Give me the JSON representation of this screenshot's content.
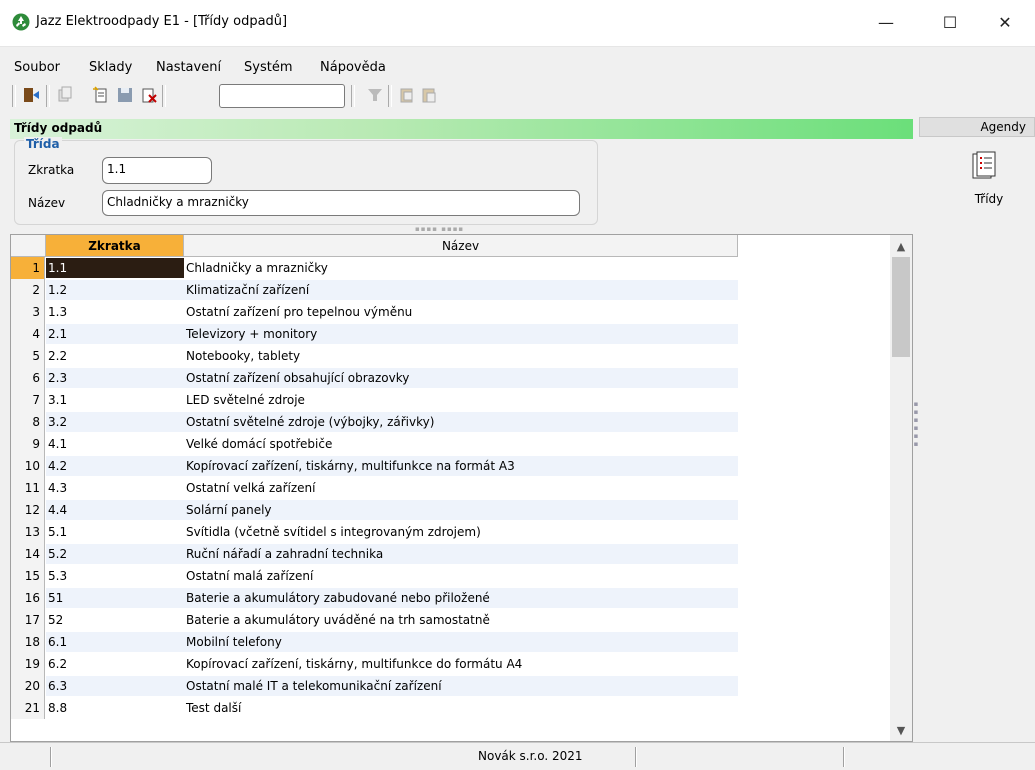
{
  "window": {
    "title": "Jazz Elektroodpady E1 - [Třídy odpadů]",
    "minimize": "—",
    "maximize": "☐",
    "close": "✕"
  },
  "menu": [
    "Soubor",
    "Sklady",
    "Nastavení",
    "Systém",
    "Nápověda"
  ],
  "toolbar": {
    "icons": [
      "exit-icon",
      "copy-icon",
      "new-record-icon",
      "save-icon",
      "delete-icon",
      "filter-icon",
      "copy-to-clipboard-icon",
      "paste-icon"
    ],
    "search_value": ""
  },
  "section": {
    "title": "Třídy odpadů",
    "group_title": "Třída",
    "zkratka_label": "Zkratka",
    "zkratka_value": "1.1",
    "nazev_label": "Název",
    "nazev_value": "Chladničky a mrazničky"
  },
  "grid": {
    "columns": [
      "Zkratka",
      "Název"
    ],
    "rows": [
      {
        "n": "1",
        "code": "1.1",
        "name": "Chladničky a mrazničky"
      },
      {
        "n": "2",
        "code": "1.2",
        "name": "Klimatizační zařízení"
      },
      {
        "n": "3",
        "code": "1.3",
        "name": "Ostatní zařízení pro tepelnou výměnu"
      },
      {
        "n": "4",
        "code": "2.1",
        "name": "Televizory + monitory"
      },
      {
        "n": "5",
        "code": "2.2",
        "name": "Notebooky, tablety"
      },
      {
        "n": "6",
        "code": "2.3",
        "name": "Ostatní zařízení obsahující obrazovky"
      },
      {
        "n": "7",
        "code": "3.1",
        "name": "LED světelné zdroje"
      },
      {
        "n": "8",
        "code": "3.2",
        "name": "Ostatní světelné zdroje (výbojky, zářivky)"
      },
      {
        "n": "9",
        "code": "4.1",
        "name": "Velké domácí spotřebiče"
      },
      {
        "n": "10",
        "code": "4.2",
        "name": "Kopírovací zařízení, tiskárny, multifunkce na formát A3"
      },
      {
        "n": "11",
        "code": "4.3",
        "name": "Ostatní velká zařízení"
      },
      {
        "n": "12",
        "code": "4.4",
        "name": "Solární panely"
      },
      {
        "n": "13",
        "code": "5.1",
        "name": "Svítidla (včetně svítidel s integrovaným zdrojem)"
      },
      {
        "n": "14",
        "code": "5.2",
        "name": "Ruční nářadí a zahradní technika"
      },
      {
        "n": "15",
        "code": "5.3",
        "name": "Ostatní malá zařízení"
      },
      {
        "n": "16",
        "code": "51",
        "name": "Baterie a akumulátory zabudované nebo přiložené"
      },
      {
        "n": "17",
        "code": "52",
        "name": "Baterie a akumulátory uváděné na trh samostatně"
      },
      {
        "n": "18",
        "code": "6.1",
        "name": "Mobilní telefony"
      },
      {
        "n": "19",
        "code": "6.2",
        "name": "Kopírovací zařízení, tiskárny, multifunkce do formátu A4"
      },
      {
        "n": "20",
        "code": "6.3",
        "name": "Ostatní malé IT a telekomunikační zařízení"
      },
      {
        "n": "21",
        "code": "8.8",
        "name": "Test další"
      }
    ]
  },
  "sidepanel": {
    "header": "Agendy",
    "item_label": "Třídy"
  },
  "statusbar": {
    "text": "Novák s.r.o. 2021"
  },
  "colors": {
    "accent_orange": "#f7b039",
    "selected_cell": "#2b1d12",
    "header_green": "#6bdf7a",
    "group_title_blue": "#1f5fa8"
  }
}
